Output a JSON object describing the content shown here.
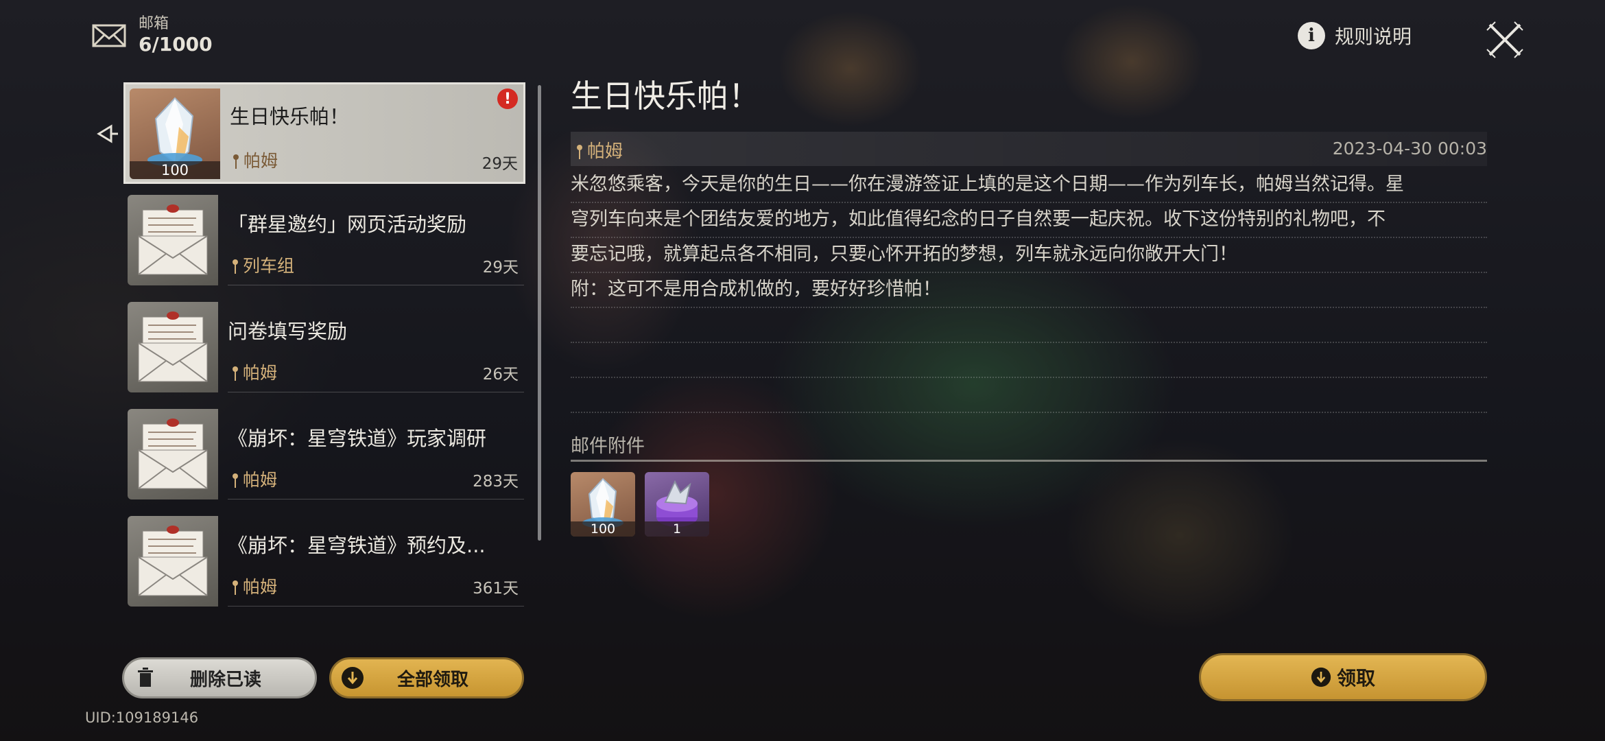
{
  "header": {
    "mailbox_label": "邮箱",
    "mailbox_count": "6/1000",
    "rules_label": "规则说明"
  },
  "mails": [
    {
      "title": "生日快乐帕！",
      "sender": "帕姆",
      "days": "29天",
      "thumb_qty": "100",
      "unread_badge": "!"
    },
    {
      "title": "「群星邀约」网页活动奖励",
      "sender": "列车组",
      "days": "29天"
    },
    {
      "title": "问卷填写奖励",
      "sender": "帕姆",
      "days": "26天"
    },
    {
      "title": "《崩坏：星穹铁道》玩家调研",
      "sender": "帕姆",
      "days": "283天"
    },
    {
      "title": "《崩坏：星穹铁道》预约及...",
      "sender": "帕姆",
      "days": "361天"
    }
  ],
  "actions": {
    "delete_read": "删除已读",
    "claim_all": "全部领取",
    "claim": "领取"
  },
  "uid": "UID:109189146",
  "detail": {
    "title": "生日快乐帕！",
    "sender": "帕姆",
    "date": "2023-04-30 00:03",
    "body_lines": [
      "米忽悠乘客，今天是你的生日——你在漫游签证上填的是这个日期——作为列车长，帕姆当然记得。星",
      "穹列车向来是个团结友爱的地方，如此值得纪念的日子自然要一起庆祝。收下这份特别的礼物吧，不",
      "要忘记哦，就算起点各不相同，只要心怀开拓的梦想，列车就永远向你敞开大门！",
      "附：这可不是用合成机做的，要好好珍惜帕！",
      "",
      "",
      ""
    ],
    "attachments_label": "邮件附件",
    "attachments": [
      {
        "name": "stellar-jade",
        "qty": "100"
      },
      {
        "name": "purple-item",
        "qty": "1"
      }
    ]
  },
  "colors": {
    "accent_gold": "#d4b17a",
    "button_gold": "#e2b451",
    "badge_red": "#d42a22"
  }
}
